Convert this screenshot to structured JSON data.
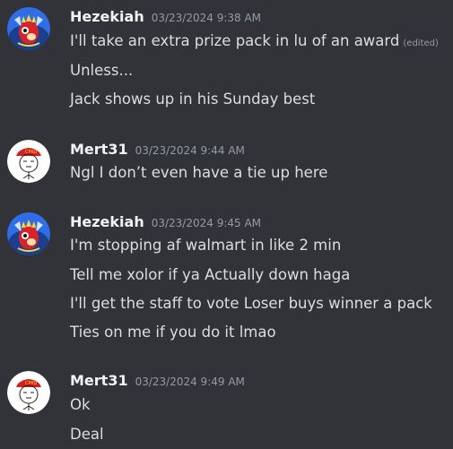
{
  "messages": [
    {
      "username": "Hezekiah",
      "timestamp": "03/23/2024 9:38 AM",
      "avatar_icon": "red-dragon-avatar",
      "lines": [
        "I'll take an extra prize pack in lu of an award",
        "Unless...",
        "Jack shows up in his Sunday best"
      ],
      "edited_label": "(edited)"
    },
    {
      "username": "Mert31",
      "timestamp": "03/23/2024 9:44 AM",
      "avatar_icon": "meme-face-red-cap-avatar",
      "avatar_cap_text": "CPKU",
      "lines": [
        "Ngl I don’t even have a tie up here"
      ]
    },
    {
      "username": "Hezekiah",
      "timestamp": "03/23/2024 9:45 AM",
      "avatar_icon": "red-dragon-avatar",
      "lines": [
        "I'm stopping af walmart in like 2 min",
        "Tell me xolor if ya Actually down haga",
        "I'll get the staff to vote Loser buys winner a pack",
        "Ties on me if you do it lmao"
      ]
    },
    {
      "username": "Mert31",
      "timestamp": "03/23/2024 9:49 AM",
      "avatar_icon": "meme-face-red-cap-avatar",
      "avatar_cap_text": "CPKU",
      "lines": [
        "Ok",
        "Deal"
      ]
    }
  ],
  "colors": {
    "background": "#313338",
    "username": "#f2f3f5",
    "timestamp": "#949ba4",
    "message_text": "#dbdee1"
  }
}
